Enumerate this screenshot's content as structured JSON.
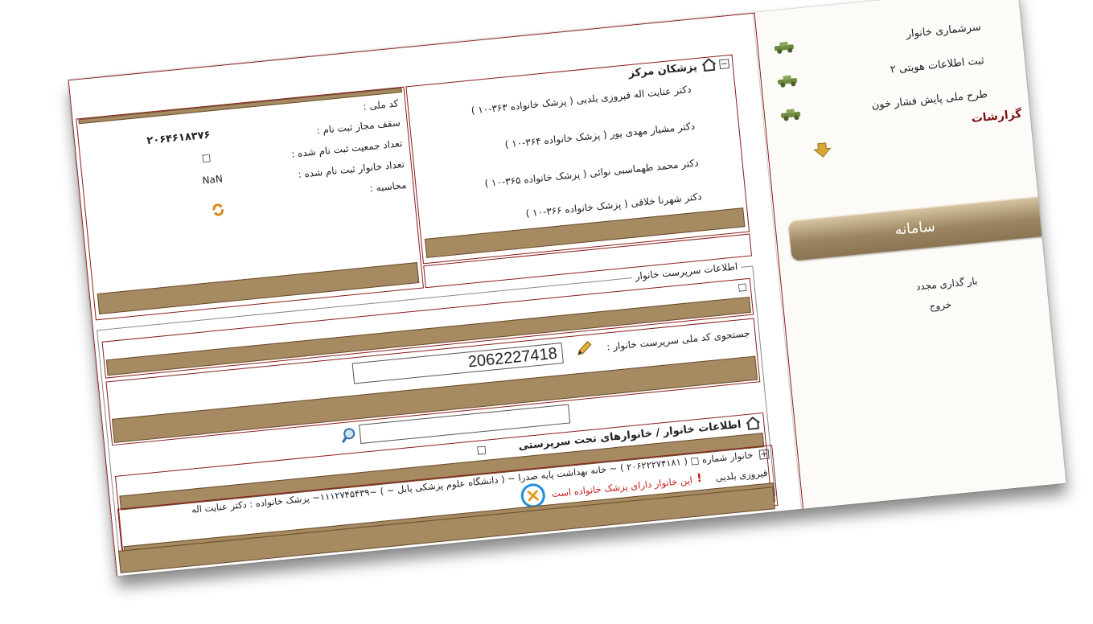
{
  "sidebar": {
    "menu": [
      {
        "label": "سرشماری خانوار"
      },
      {
        "label": "ثبت اطلاعات هویتی ۲"
      },
      {
        "label": "طرح ملی پایش فشار خون"
      }
    ],
    "reports_label": "گزارشات",
    "system_button": "سامانه",
    "links": [
      "بار گذاری مجدد",
      "خروج"
    ]
  },
  "centers": {
    "title": "پزشکان مرکز",
    "doctors": [
      "دکتر عنایت اله قیروزی بلدیی ( پزشک خانواده ۳۶۳-۱۰ )",
      "دکتر مشیار مهدی پور ( پزشک خانواده ۳۶۴-۱۰ )",
      "دکتر محمد طهماسبی نوائی ( پزشک خانواده ۳۶۵-۱۰ )",
      "دکتر شهرنا خلاقی ( پزشک خانواده ۳۶۶-۱۰ )"
    ]
  },
  "stats": {
    "national_code_label": "کد ملی :",
    "quota_label": "سقف مجاز ثبت نام :",
    "quota_value": "۲۰۶۴۶۱۸۳۷۶",
    "population_label": "تعداد جمعیت ثبت نام شده :",
    "population_value": "□",
    "families_label": "تعداد خانوار ثبت نام شده :",
    "families_value": "NaN",
    "calc_label": "محاسبه :"
  },
  "head_of_family": {
    "legend": "اطلاعات سرپرست خانوار",
    "small_box": "□",
    "search_label": "جستجوی کد ملی سرپرست خانوار :",
    "search_value": "2062227418"
  },
  "family_info": {
    "title": "اطلاعات خانوار / خانوارهای تحت سرپرستی",
    "title_suffix": "□",
    "row_prefix": "خانوار شماره",
    "row_text": "خانوار شماره □ ( ۲۰۶۲۲۲۷۴۱۸۱ ) ~ خانه بهداشت پایه صدرا ~ ( دانشگاه علوم پزشکی بابل ~ ) ~۱۱۱۲۷۴۵۴۳۹~ پزشک خانواده : دکتر عنایت اله",
    "warning_text": "قیروزی بلدیی",
    "warning_marker": "!",
    "warning_message": "این خانوار دارای پزشک خانواده است"
  },
  "colors": {
    "accent": "#8b1a1a",
    "strip": "#a58a62",
    "highlight": "#1e8fd8",
    "icon_orange": "#e49a23"
  }
}
